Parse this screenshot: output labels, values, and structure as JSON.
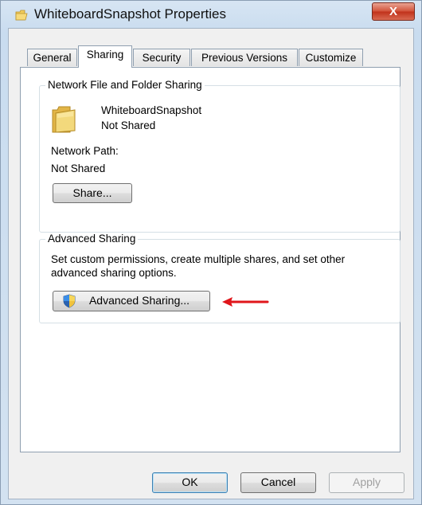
{
  "window": {
    "title": "WhiteboardSnapshot Properties",
    "close_glyph": "X"
  },
  "tabs": [
    "General",
    "Sharing",
    "Security",
    "Previous Versions",
    "Customize"
  ],
  "active_tab": "Sharing",
  "network_sharing": {
    "group_label": "Network File and Folder Sharing",
    "item_name": "WhiteboardSnapshot",
    "item_status": "Not Shared",
    "path_label": "Network Path:",
    "path_value": "Not Shared",
    "share_button": "Share..."
  },
  "advanced_sharing": {
    "group_label": "Advanced Sharing",
    "description_line1": "Set custom permissions, create multiple shares, and set other",
    "description_line2": "advanced sharing options.",
    "button_label": "Advanced Sharing..."
  },
  "footer": {
    "ok": "OK",
    "cancel": "Cancel",
    "apply": "Apply"
  },
  "colors": {
    "folder": "#e9c354",
    "annotation_arrow": "#e0161b",
    "close_button": "#c8452c"
  },
  "icons": {
    "title": "folder-icon",
    "item": "folder-icon",
    "advanced_button": "uac-shield-icon",
    "annotation": "red-arrow-icon"
  }
}
